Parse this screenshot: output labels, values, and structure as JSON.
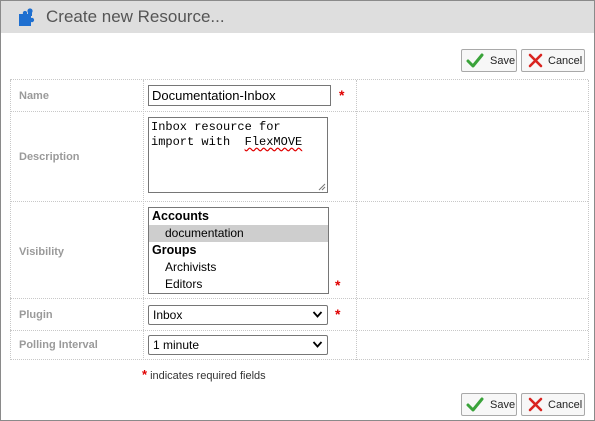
{
  "window": {
    "title": "Create new Resource...",
    "icon": "puzzle-piece-icon",
    "accent": "#1e6fd0"
  },
  "toolbar": {
    "save_label": "Save",
    "cancel_label": "Cancel"
  },
  "form": {
    "name": {
      "label": "Name",
      "value": "Documentation-Inbox",
      "required": true
    },
    "description": {
      "label": "Description",
      "line1": "Inbox resource for",
      "line2_prefix": "import with  ",
      "line2_word": "FlexMOVE"
    },
    "visibility": {
      "label": "Visibility",
      "required": true,
      "groups": [
        {
          "heading": "Accounts",
          "options": [
            {
              "label": "documentation",
              "selected": true
            }
          ]
        },
        {
          "heading": "Groups",
          "options": [
            {
              "label": "Archivists",
              "selected": false
            },
            {
              "label": "Editors",
              "selected": false
            }
          ]
        }
      ]
    },
    "plugin": {
      "label": "Plugin",
      "value": "Inbox",
      "required": true
    },
    "polling": {
      "label": "Polling Interval",
      "value": "1 minute"
    }
  },
  "required_mark": "*",
  "footer_note": "indicates required fields",
  "colors": {
    "required": "#e00000",
    "save_check": "#3aa33a",
    "cancel_x": "#d9231f"
  }
}
